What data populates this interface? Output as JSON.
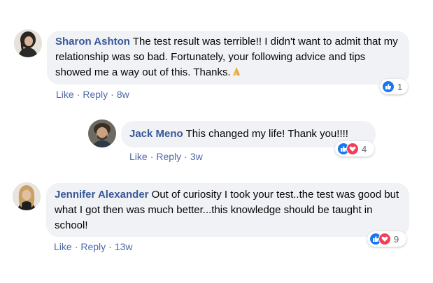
{
  "comments": [
    {
      "author": "Sharon Ashton",
      "text": "The test result was terrible!! I didn't want to admit that my relationship was so bad. Fortunately, your following advice and tips showed me a way out of this. Thanks.",
      "emoji": "folded-hands",
      "like_label": "Like",
      "sep": "·",
      "reply_label": "Reply",
      "time": "8w",
      "reactions": [
        "like"
      ],
      "reaction_count": "1"
    },
    {
      "author": "Jack Meno",
      "text": "This changed my life! Thank you!!!!",
      "like_label": "Like",
      "sep": "·",
      "reply_label": "Reply",
      "time": "3w",
      "reactions": [
        "like",
        "love"
      ],
      "reaction_count": "4"
    },
    {
      "author": "Jennifer Alexander",
      "text": "Out of curiosity I took your test..the test was good but what I got then was much better...this knowledge should be taught in school!",
      "like_label": "Like",
      "sep": "·",
      "reply_label": "Reply",
      "time": "13w",
      "reactions": [
        "like",
        "love"
      ],
      "reaction_count": "9"
    }
  ],
  "colors": {
    "author": "#385898",
    "bubble": "#f0f2f5",
    "like_reaction": "#1877f2",
    "love_reaction": "#f33e58"
  }
}
